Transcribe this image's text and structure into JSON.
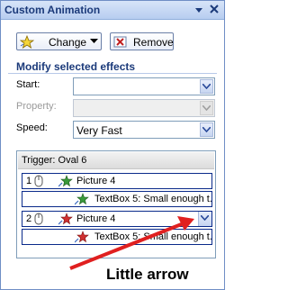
{
  "pane": {
    "title": "Custom Animation"
  },
  "toolbar": {
    "change_label": "Change",
    "remove_label": "Remove"
  },
  "modify": {
    "heading": "Modify selected effects",
    "start_label": "Start:",
    "start_value": "",
    "property_label": "Property:",
    "property_value": "",
    "speed_label": "Speed:",
    "speed_value": "Very Fast"
  },
  "effects_list": {
    "trigger_label": "Trigger: Oval 6",
    "items": [
      {
        "seq": "1",
        "name": "Picture 4",
        "kind": "entrance"
      },
      {
        "seq": "",
        "name": "TextBox 5: Small enough t...",
        "kind": "entrance"
      },
      {
        "seq": "2",
        "name": "Picture 4",
        "kind": "exit"
      },
      {
        "seq": "",
        "name": "TextBox 5: Small enough t...",
        "kind": "exit"
      }
    ]
  },
  "annotation": {
    "caption": "Little arrow"
  },
  "colors": {
    "title_text": "#1b3a7a",
    "selection_border": "#0a2a8a",
    "annotation_arrow": "#e02020",
    "entrance_star": "#3a9a3a",
    "exit_star": "#d03030"
  }
}
